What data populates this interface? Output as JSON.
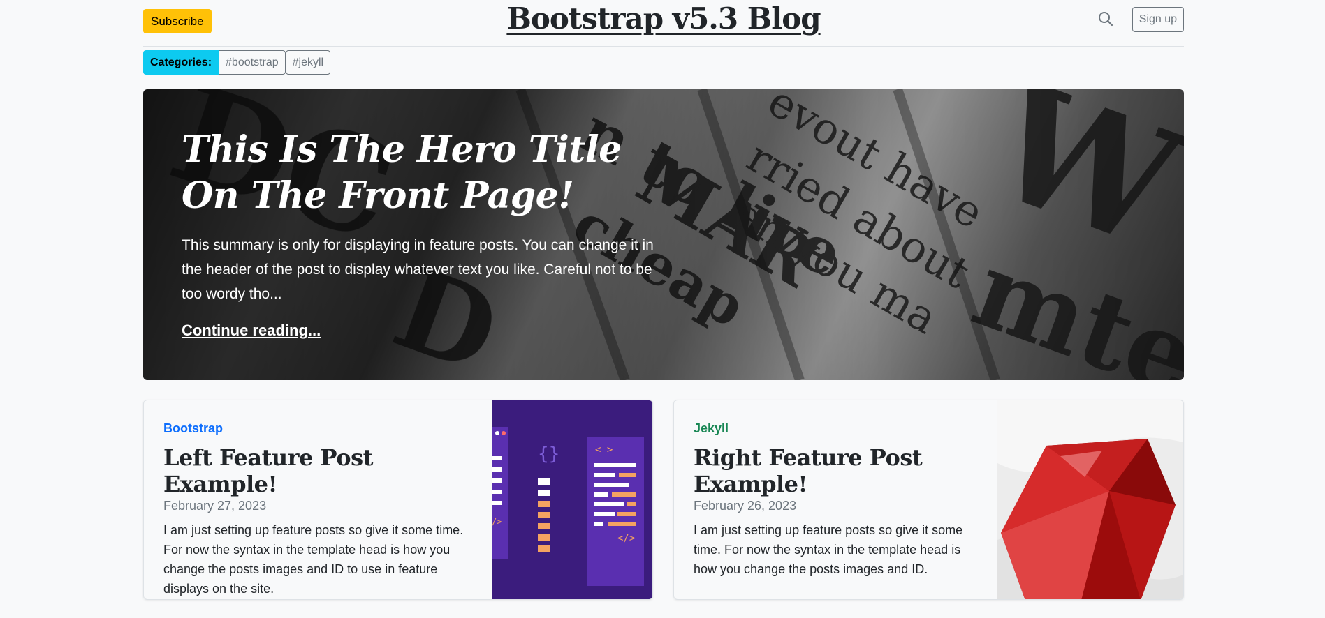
{
  "header": {
    "subscribe_label": "Subscribe",
    "title": "Bootstrap v5.3 Blog",
    "signup_label": "Sign up"
  },
  "categories": {
    "label": "Categories:",
    "tags": [
      "#bootstrap",
      "#jekyll"
    ]
  },
  "hero": {
    "title": "This Is The Hero Title On The Front Page!",
    "summary": "This summary is only for displaying in feature posts. You can change it in the header of the post to display whatever text you like. Careful not to be too wordy tho...",
    "link_label": "Continue reading..."
  },
  "features": [
    {
      "category": "Bootstrap",
      "title": "Left Feature Post Example!",
      "date": "February 27, 2023",
      "excerpt": "I am just setting up feature posts so give it some time. For now the syntax in the template head is how you change the posts images and ID to use in feature displays on the site.",
      "image_icon": "code-editor-illustration"
    },
    {
      "category": "Jekyll",
      "title": "Right Feature Post Example!",
      "date": "February 26, 2023",
      "excerpt": "I am just setting up feature posts so give it some time. For now the syntax in the template head is how you change the posts images and ID.",
      "image_icon": "ruby-gem-illustration"
    }
  ],
  "colors": {
    "subscribe": "#ffc107",
    "category_badge": "#0dcaf0",
    "bootstrap_cat": "#0d6efd",
    "jekyll_cat": "#198754"
  }
}
